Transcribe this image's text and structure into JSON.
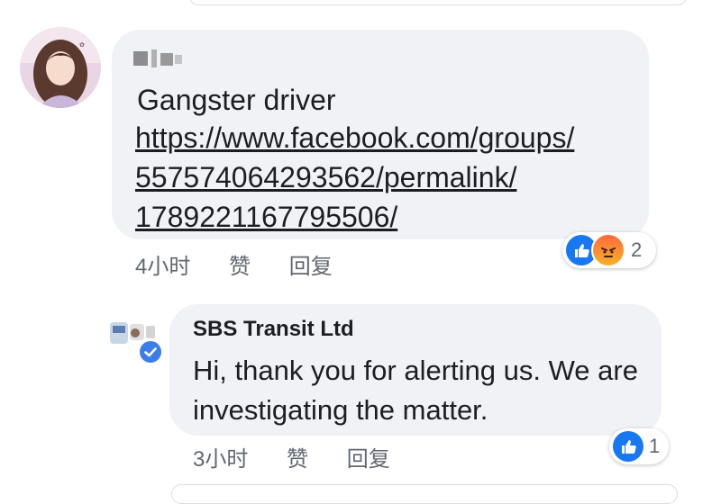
{
  "comment1": {
    "message": "Gangster  driver",
    "link_lines": [
      "https://www.facebook.com/groups/",
      "557574064293562/permalink/",
      "1789221167795506/"
    ],
    "time": "4小时",
    "like_label": "赞",
    "reply_label": "回复",
    "reactions": {
      "icons": [
        "like-icon",
        "angry-icon"
      ],
      "count": "2"
    }
  },
  "reply1": {
    "author": "SBS Transit Ltd",
    "message": "Hi, thank you for alerting us. We are investigating the matter.",
    "time": "3小时",
    "like_label": "赞",
    "reply_label": "回复",
    "reactions": {
      "icons": [
        "like-icon"
      ],
      "count": "1"
    }
  },
  "colors": {
    "bubble": "#f0f2f5",
    "like_blue": "#1877f2",
    "meta_gray": "#606770"
  }
}
